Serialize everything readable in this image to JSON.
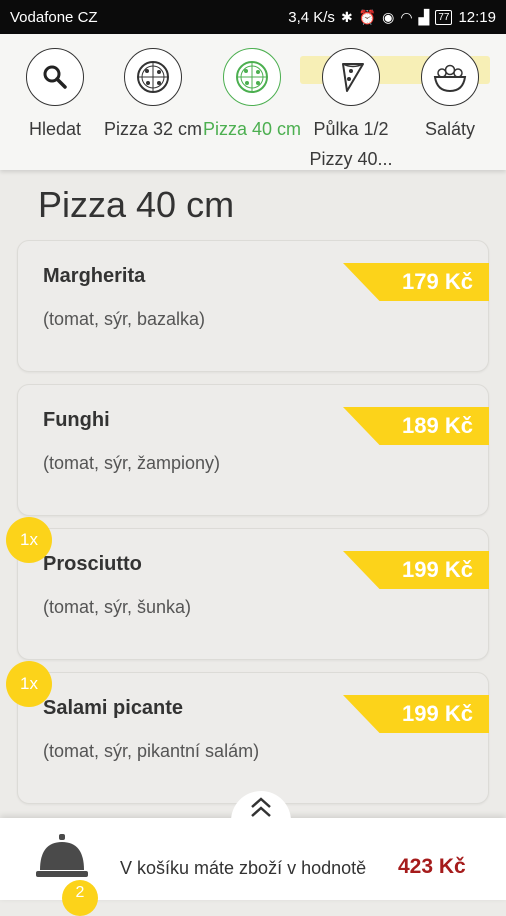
{
  "status_bar": {
    "carrier": "Vodafone CZ",
    "speed": "3,4 K/s",
    "battery": "77",
    "time": "12:19"
  },
  "categories": [
    {
      "label": "Hledat",
      "icon": "search-icon",
      "active": false
    },
    {
      "label": "Pizza 32 cm",
      "icon": "pizza-icon",
      "active": false
    },
    {
      "label": "Pizza 40 cm",
      "icon": "pizza-icon",
      "active": true
    },
    {
      "label": "Půlka 1/2 Pizzy 40...",
      "icon": "pizza-slice-icon",
      "active": false
    },
    {
      "label": "Saláty",
      "icon": "salad-icon",
      "active": false
    }
  ],
  "section_title": "Pizza 40 cm",
  "products": [
    {
      "name": "Margherita",
      "desc": "(tomat, sýr, bazalka)",
      "price": "179 Kč",
      "qty": null
    },
    {
      "name": "Funghi",
      "desc": "(tomat, sýr, žampiony)",
      "price": "189 Kč",
      "qty": null
    },
    {
      "name": "Prosciutto",
      "desc": "(tomat, sýr, šunka)",
      "price": "199 Kč",
      "qty": "1x"
    },
    {
      "name": "Salami picante",
      "desc": "(tomat, sýr, pikantní salám)",
      "price": "199 Kč",
      "qty": "1x"
    }
  ],
  "cart": {
    "text": "V košíku máte zboží v hodnotě",
    "total": "423 Kč",
    "count": "2"
  },
  "colors": {
    "accent_yellow": "#fcd31a",
    "active_green": "#4caf50",
    "total_red": "#a51b1b"
  }
}
